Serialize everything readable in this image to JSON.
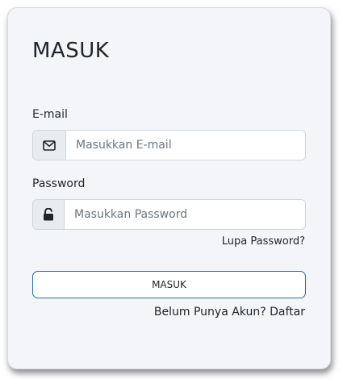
{
  "form": {
    "title": "MASUK",
    "email": {
      "label": "E-mail",
      "placeholder": "Masukkan E-mail",
      "value": "",
      "icon": "envelope-icon"
    },
    "password": {
      "label": "Password",
      "placeholder": "Masukkan Password",
      "value": "",
      "icon": "unlock-icon"
    },
    "forgot_label": "Lupa Password?",
    "submit_label": "MASUK",
    "register_prompt": "Belum Punya Akun?",
    "register_link": "Daftar"
  },
  "colors": {
    "card_background": "#f3f5f9",
    "button_border": "#2c6cb0",
    "addon_background": "#e9ecef"
  }
}
